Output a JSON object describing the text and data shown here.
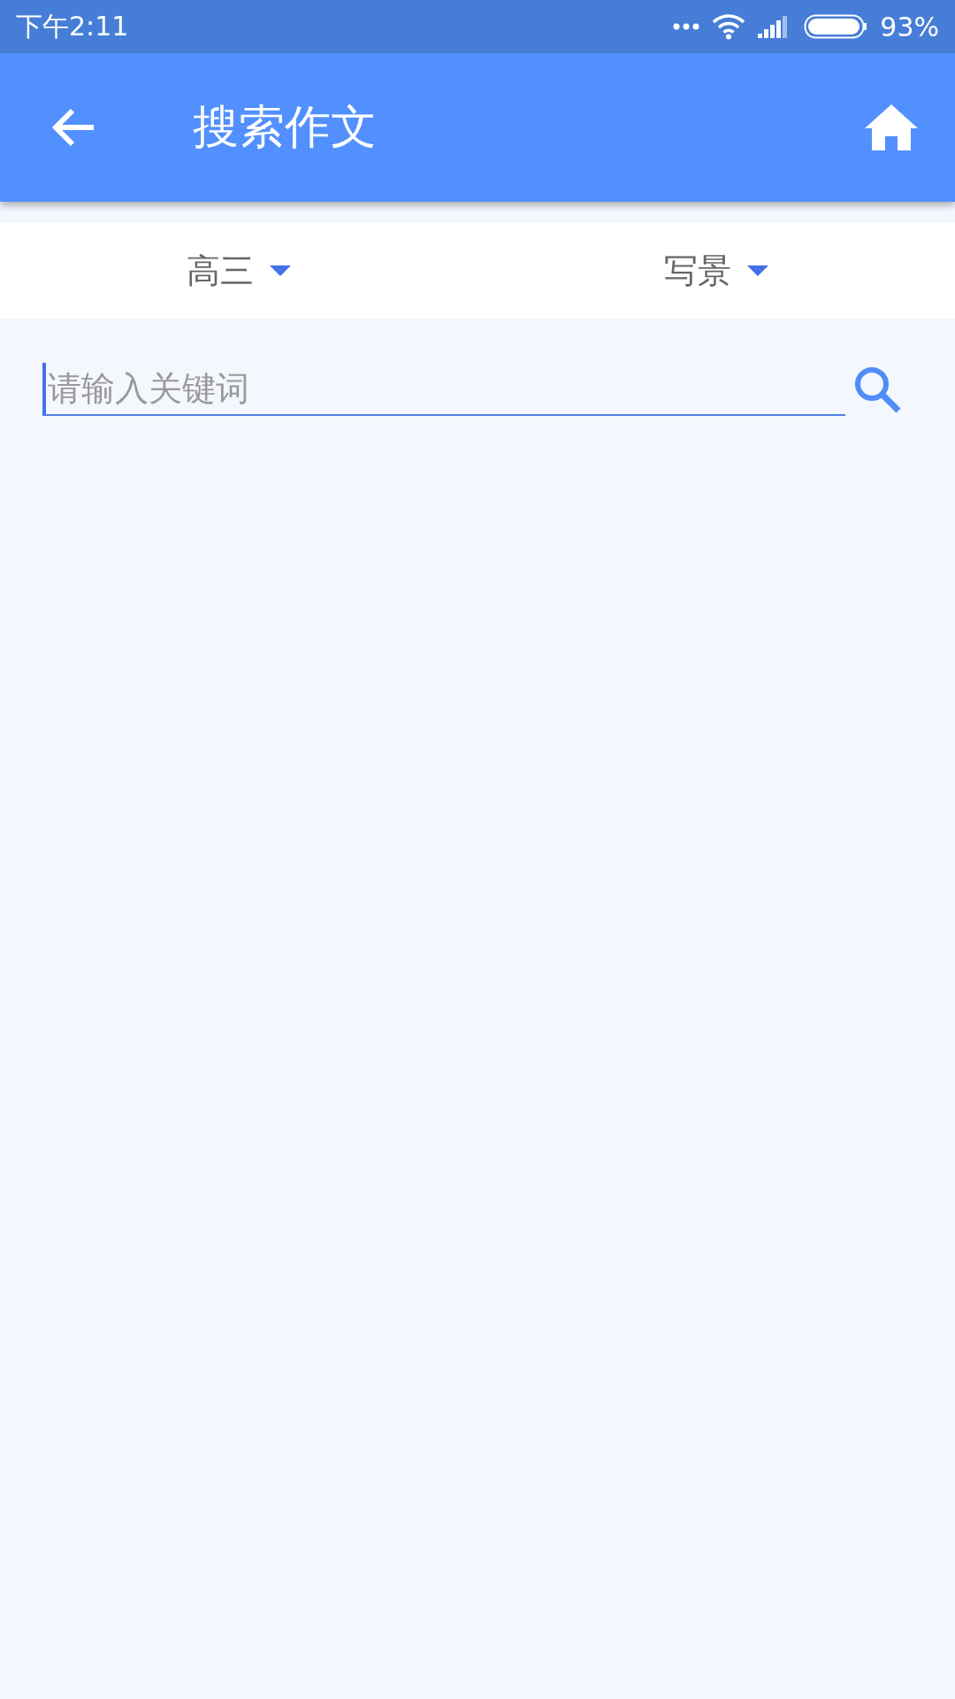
{
  "status_bar": {
    "time": "下午2:11",
    "battery": "93%"
  },
  "app_bar": {
    "title": "搜索作文"
  },
  "filters": [
    {
      "label": "高三"
    },
    {
      "label": "写景"
    }
  ],
  "search": {
    "placeholder": "请输入关键词",
    "focused": true
  }
}
